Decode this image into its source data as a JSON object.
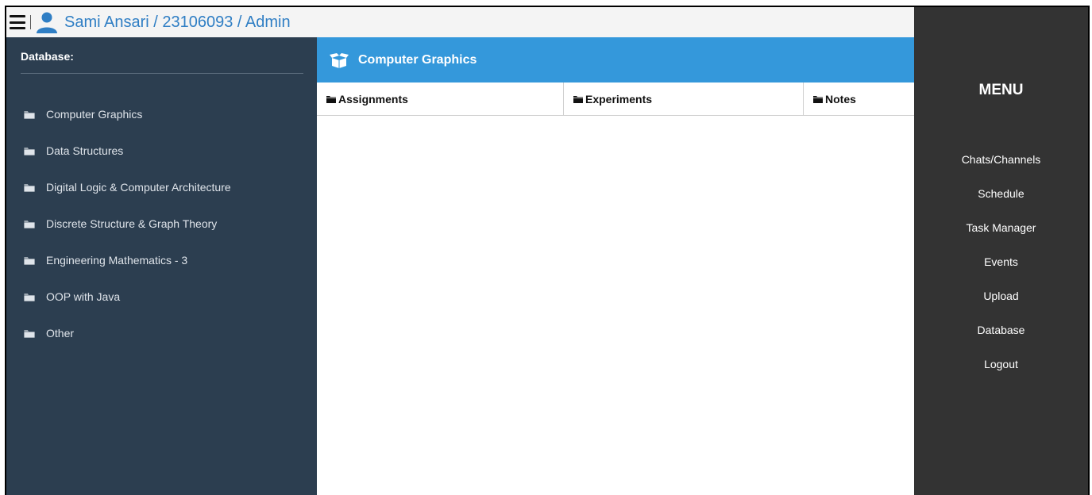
{
  "header": {
    "menu_icon": "hamburger-icon",
    "user_icon": "user-icon",
    "user_title": "Sami Ansari / 23106093 / Admin",
    "accent": "#2f7ec4"
  },
  "sidebar": {
    "heading": "Database:",
    "background": "#2c3e50",
    "items": [
      {
        "label": "Computer Graphics",
        "icon": "folder-icon"
      },
      {
        "label": "Data Structures",
        "icon": "folder-icon"
      },
      {
        "label": "Digital Logic & Computer Architecture",
        "icon": "folder-icon"
      },
      {
        "label": "Discrete Structure & Graph Theory",
        "icon": "folder-icon"
      },
      {
        "label": "Engineering Mathematics - 3",
        "icon": "folder-icon"
      },
      {
        "label": "OOP with Java",
        "icon": "folder-icon"
      },
      {
        "label": "Other",
        "icon": "folder-icon"
      }
    ]
  },
  "content": {
    "title": "Computer Graphics",
    "title_icon": "open-box-icon",
    "header_color": "#3498db",
    "tabs": [
      {
        "label": "Assignments",
        "icon": "folder-icon"
      },
      {
        "label": "Experiments",
        "icon": "folder-icon"
      },
      {
        "label": "Notes",
        "icon": "folder-icon"
      }
    ]
  },
  "menu": {
    "title": "MENU",
    "background": "#333333",
    "items": [
      {
        "label": "Chats/Channels"
      },
      {
        "label": "Schedule"
      },
      {
        "label": "Task Manager"
      },
      {
        "label": "Events"
      },
      {
        "label": "Upload"
      },
      {
        "label": "Database"
      },
      {
        "label": "Logout"
      }
    ]
  }
}
